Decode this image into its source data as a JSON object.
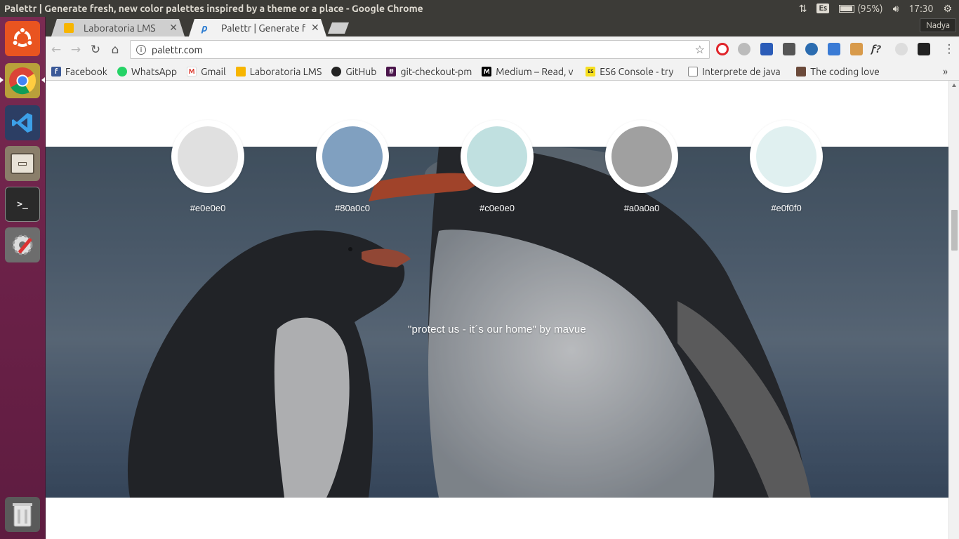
{
  "system": {
    "window_title": "Palettr | Generate fresh, new color palettes inspired by a theme or a place - Google Chrome",
    "keyboard_layout": "Es",
    "battery": "(95%)",
    "time": "17:30",
    "user": "Nadya"
  },
  "tabs": [
    {
      "label": "Laboratoria LMS",
      "close": "✕"
    },
    {
      "label": "Palettr | Generate f",
      "close": "✕"
    }
  ],
  "toolbar": {
    "url": "palettr.com",
    "info": "i",
    "star": "☆"
  },
  "bookmarks": [
    {
      "label": "Facebook",
      "icon": "f"
    },
    {
      "label": "WhatsApp",
      "icon": "w"
    },
    {
      "label": "Gmail",
      "icon": "M"
    },
    {
      "label": "Laboratoria LMS",
      "icon": "<>"
    },
    {
      "label": "GitHub",
      "icon": "gh"
    },
    {
      "label": "git-checkout-pm",
      "icon": "#"
    },
    {
      "label": "Medium – Read, v",
      "icon": "M"
    },
    {
      "label": "ES6 Console - try",
      "icon": "ES"
    },
    {
      "label": "Interprete de java",
      "icon": "doc"
    },
    {
      "label": "The coding love",
      "icon": "img"
    }
  ],
  "bookmarks_more": "»",
  "palette": [
    {
      "hex": "#e0e0e0"
    },
    {
      "hex": "#80a0c0"
    },
    {
      "hex": "#c0e0e0"
    },
    {
      "hex": "#a0a0a0"
    },
    {
      "hex": "#e0f0f0"
    }
  ],
  "credit": "\"protect us - it´s our home\" by mavue"
}
